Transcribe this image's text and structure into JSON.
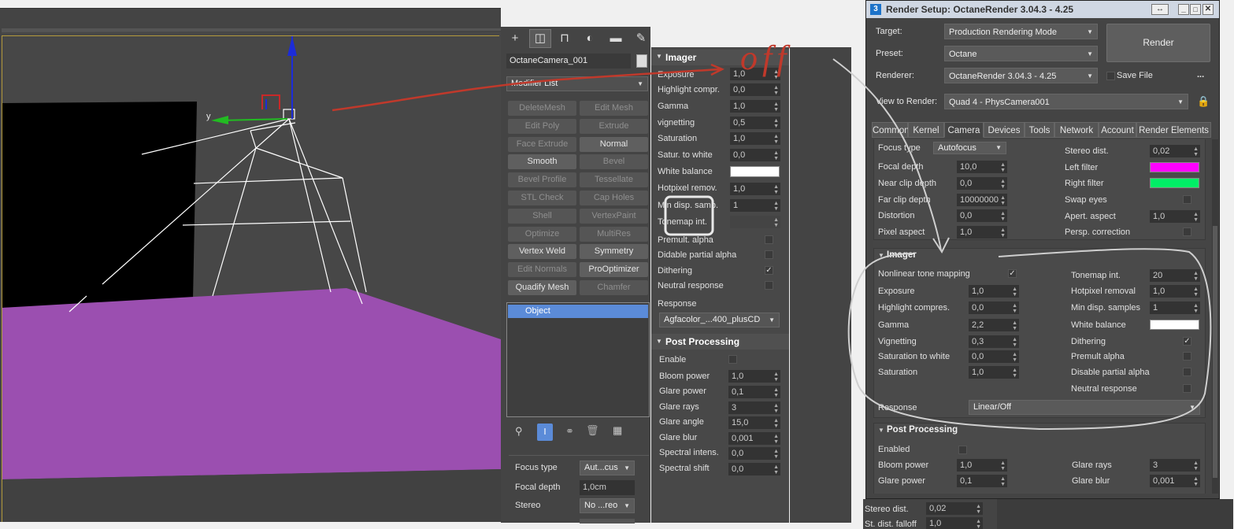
{
  "command_panel": {
    "object_name": "OctaneCamera_001",
    "modifier_list": "Modifier List",
    "buttons": [
      {
        "label": "DeleteMesh",
        "enabled": false
      },
      {
        "label": "Edit Mesh",
        "enabled": false
      },
      {
        "label": "Edit Poly",
        "enabled": false
      },
      {
        "label": "Extrude",
        "enabled": false
      },
      {
        "label": "Face Extrude",
        "enabled": false
      },
      {
        "label": "Normal",
        "enabled": true
      },
      {
        "label": "Smooth",
        "enabled": true
      },
      {
        "label": "Bevel",
        "enabled": false
      },
      {
        "label": "Bevel Profile",
        "enabled": false
      },
      {
        "label": "Tessellate",
        "enabled": false
      },
      {
        "label": "STL Check",
        "enabled": false
      },
      {
        "label": "Cap Holes",
        "enabled": false
      },
      {
        "label": "Shell",
        "enabled": false
      },
      {
        "label": "VertexPaint",
        "enabled": false
      },
      {
        "label": "Optimize",
        "enabled": false
      },
      {
        "label": "MultiRes",
        "enabled": false
      },
      {
        "label": "Vertex Weld",
        "enabled": true
      },
      {
        "label": "Symmetry",
        "enabled": true
      },
      {
        "label": "Edit Normals",
        "enabled": false
      },
      {
        "label": "ProOptimizer",
        "enabled": true
      },
      {
        "label": "Quadify Mesh",
        "enabled": true
      },
      {
        "label": "Chamfer",
        "enabled": false
      }
    ],
    "stack_item": "Object",
    "focus_type_label": "Focus type",
    "focus_type_value": "Aut...cus",
    "focal_depth_label": "Focal depth",
    "focal_depth_value": "1,0cm",
    "stereo_label": "Stereo",
    "stereo_value": "No ...reo"
  },
  "imager_rollout": {
    "title": "Imager",
    "exposure": {
      "label": "Exposure",
      "value": "1,0"
    },
    "highlight": {
      "label": "Highlight compr.",
      "value": "0,0"
    },
    "gamma": {
      "label": "Gamma",
      "value": "1,0"
    },
    "vignetting": {
      "label": "vignetting",
      "value": "0,5"
    },
    "saturation": {
      "label": "Saturation",
      "value": "1,0"
    },
    "satur_white": {
      "label": "Satur. to white",
      "value": "0,0"
    },
    "white_balance": {
      "label": "White balance"
    },
    "hotpixel": {
      "label": "Hotpixel remov.",
      "value": "1,0"
    },
    "min_disp": {
      "label": "Min disp. samp.",
      "value": "1"
    },
    "tonemap": {
      "label": "Tonemap int."
    },
    "premult": {
      "label": "Premult. alpha"
    },
    "didable": {
      "label": "Didable partial alpha"
    },
    "dithering": {
      "label": "Dithering"
    },
    "neutral": {
      "label": "Neutral response"
    },
    "response_label": "Response",
    "response_value": "Agfacolor_...400_plusCD",
    "post_title": "Post Processing",
    "enable": {
      "label": "Enable"
    },
    "bloom": {
      "label": "Bloom power",
      "value": "1,0"
    },
    "glare_power": {
      "label": "Glare power",
      "value": "0,1"
    },
    "glare_rays": {
      "label": "Glare rays",
      "value": "3"
    },
    "glare_angle": {
      "label": "Glare angle",
      "value": "15,0"
    },
    "glare_blur": {
      "label": "Glare blur",
      "value": "0,001"
    },
    "spectral_int": {
      "label": "Spectral intens.",
      "value": "0,0"
    },
    "spectral_shift": {
      "label": "Spectral shift",
      "value": "0,0"
    }
  },
  "render_setup": {
    "title": "Render Setup: OctaneRender 3.04.3 - 4.25",
    "target_label": "Target:",
    "target_value": "Production Rendering Mode",
    "preset_label": "Preset:",
    "preset_value": "Octane",
    "renderer_label": "Renderer:",
    "renderer_value": "OctaneRender 3.04.3 - 4.25",
    "save_file": "Save File",
    "more": "...",
    "render_button": "Render",
    "view_label": "View to Render:",
    "view_value": "Quad 4 - PhysCamera001",
    "tabs": [
      "Common",
      "Kernel",
      "Camera",
      "Devices",
      "Tools",
      "Network",
      "Account",
      "Render Elements"
    ],
    "camera": {
      "focus_type": {
        "label": "Focus type",
        "value": "Autofocus"
      },
      "focal_depth": {
        "label": "Focal depth",
        "value": "10,0"
      },
      "near_clip": {
        "label": "Near clip depth",
        "value": "0,0"
      },
      "far_clip": {
        "label": "Far clip depth",
        "value": "10000000"
      },
      "distortion": {
        "label": "Distortion",
        "value": "0,0"
      },
      "pixel_aspect": {
        "label": "Pixel aspect",
        "value": "1,0"
      },
      "stereo_dist": {
        "label": "Stereo dist.",
        "value": "0,02"
      },
      "left_filter": {
        "label": "Left filter",
        "color": "#ff00ff"
      },
      "right_filter": {
        "label": "Right filter",
        "color": "#00ee66"
      },
      "swap_eyes": {
        "label": "Swap eyes"
      },
      "apert_aspect": {
        "label": "Apert. aspect",
        "value": "1,0"
      },
      "persp_corr": {
        "label": "Persp. correction"
      }
    },
    "imager": {
      "title": "Imager",
      "nonlinear": {
        "label": "Nonlinear tone mapping"
      },
      "exposure": {
        "label": "Exposure",
        "value": "1,0"
      },
      "highlight": {
        "label": "Highlight compres.",
        "value": "0,0"
      },
      "gamma": {
        "label": "Gamma",
        "value": "2,2"
      },
      "vignetting": {
        "label": "Vignetting",
        "value": "0,3"
      },
      "sat_white": {
        "label": "Saturation to white",
        "value": "0,0"
      },
      "saturation": {
        "label": "Saturation",
        "value": "1,0"
      },
      "tonemap": {
        "label": "Tonemap int.",
        "value": "20"
      },
      "hotpixel": {
        "label": "Hotpixel removal",
        "value": "1,0"
      },
      "min_disp": {
        "label": "Min disp. samples",
        "value": "1"
      },
      "white_balance": {
        "label": "White balance"
      },
      "dithering": {
        "label": "Dithering"
      },
      "premult": {
        "label": "Premult alpha"
      },
      "disable_partial": {
        "label": "Disable partial alpha"
      },
      "neutral": {
        "label": "Neutral response"
      },
      "response_label": "Response",
      "response_value": "Linear/Off"
    },
    "post": {
      "title": "Post Processing",
      "enabled": {
        "label": "Enabled"
      },
      "bloom": {
        "label": "Bloom power",
        "value": "1,0"
      },
      "glare_power": {
        "label": "Glare power",
        "value": "0,1"
      },
      "glare_rays": {
        "label": "Glare rays",
        "value": "3"
      },
      "glare_blur": {
        "label": "Glare blur",
        "value": "0,001"
      }
    }
  },
  "bottom_panel": {
    "stereo_dist": {
      "label": "Stereo dist.",
      "value": "0,02"
    },
    "falloff": {
      "label": "St. dist. falloff",
      "value": "1,0"
    }
  },
  "annotation_text": "off",
  "colors": {
    "accent": "#5b8bd8",
    "annotation": "#c0392b",
    "purple_plane": "#9b4fb0"
  }
}
